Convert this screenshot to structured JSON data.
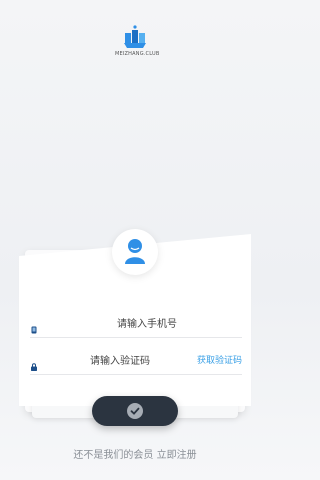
{
  "brand": {
    "logo_text": "MEIZHANG.CLUB"
  },
  "form": {
    "phone_placeholder": "请输入手机号",
    "code_placeholder": "请输入验证码",
    "get_code_label": "获取验证码"
  },
  "footer": {
    "register_prompt": "还不是我们的会员 立即注册"
  },
  "colors": {
    "accent": "#3aa0e6",
    "avatar": "#2f8fe6",
    "button": "#2b3440"
  },
  "icons": [
    "logo-icon",
    "user-avatar-icon",
    "phone-icon",
    "lock-icon",
    "checkmark-icon"
  ]
}
